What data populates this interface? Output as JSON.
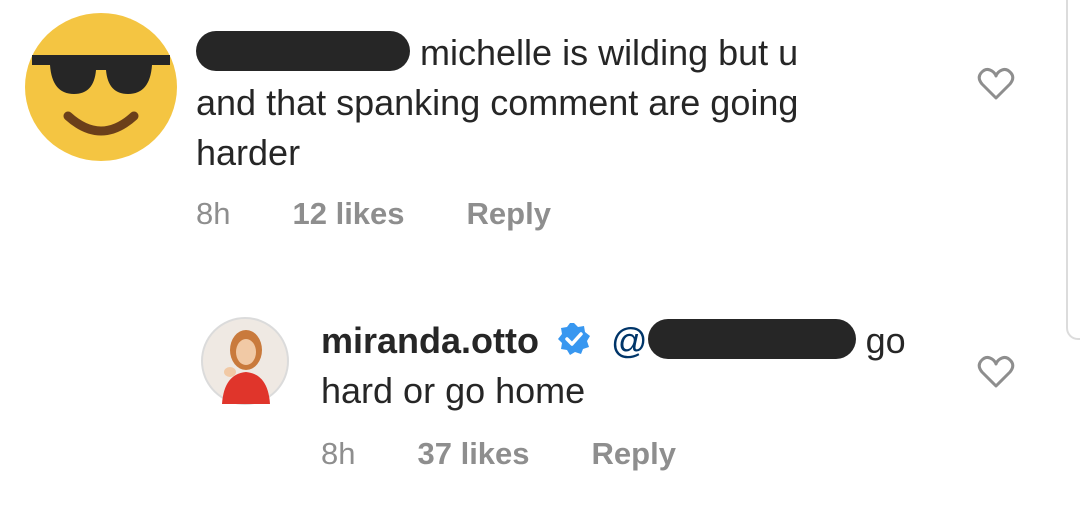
{
  "comments": [
    {
      "username": "",
      "text_line1": "michelle is wilding but u",
      "text_line2": "and that spanking comment are going",
      "text_line3": "harder",
      "time": "8h",
      "likes": "12 likes",
      "reply": "Reply",
      "avatar_icon": "sunglasses-emoji-icon"
    },
    {
      "username": "miranda.otto",
      "mention_prefix": "@",
      "text_after_mention": "go",
      "text_line2": "hard or go home",
      "time": "8h",
      "likes": "37 likes",
      "reply": "Reply",
      "verified_icon": "verified-badge-icon"
    }
  ],
  "colors": {
    "text": "#262626",
    "meta": "#8e8e8e",
    "verified": "#3897f0",
    "emoji": "#f4c542"
  }
}
